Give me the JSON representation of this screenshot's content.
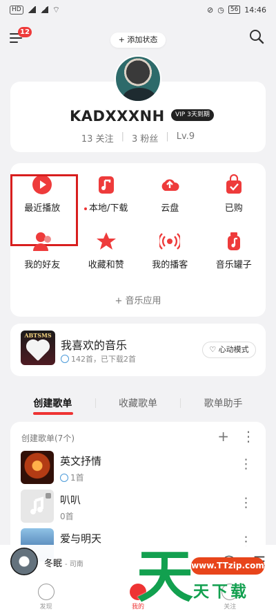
{
  "status_bar": {
    "left": "HD",
    "right_time": "14:46",
    "battery": "56"
  },
  "header": {
    "menu_badge": "12",
    "add_status": "+ 添加状态"
  },
  "profile": {
    "username": "KADXXXNH",
    "vip_badge": "VIP 3天到期",
    "following": "13 关注",
    "fans": "3 粉丝",
    "level": "Lv.9"
  },
  "grid_items": [
    {
      "label": "最近播放",
      "icon": "play-circle-icon"
    },
    {
      "label": "本地/下载",
      "icon": "music-file-icon"
    },
    {
      "label": "云盘",
      "icon": "cloud-upload-icon"
    },
    {
      "label": "已购",
      "icon": "shopping-bag-icon"
    },
    {
      "label": "我的好友",
      "icon": "friends-icon"
    },
    {
      "label": "收藏和赞",
      "icon": "star-icon"
    },
    {
      "label": "我的播客",
      "icon": "podcast-icon"
    },
    {
      "label": "音乐罐子",
      "icon": "music-jar-icon"
    }
  ],
  "add_app": "+ 音乐应用",
  "favorite": {
    "title": "我喜欢的音乐",
    "subtitle": "142首，已下载2首",
    "mode": "心动模式"
  },
  "tabs": [
    "创建歌单",
    "收藏歌单",
    "歌单助手"
  ],
  "playlist_section": {
    "header": "创建歌单(7个)",
    "add": "+",
    "more": "⋮"
  },
  "playlists": [
    {
      "title": "英文抒情",
      "count": "1首",
      "cover": "concert"
    },
    {
      "title": "叭叭",
      "count": "0首",
      "cover": "blank"
    },
    {
      "title": "爱与明天",
      "count": "",
      "cover": "portrait"
    }
  ],
  "player": {
    "song": "冬眠",
    "artist": "- 司南"
  },
  "bottom_nav": [
    {
      "label": "发现",
      "active": false
    },
    {
      "label": "我的",
      "active": true
    },
    {
      "label": "关注",
      "active": false
    }
  ],
  "watermark": {
    "main": "天",
    "url": "www.TTzip.com",
    "sub": "天下载"
  },
  "colors": {
    "accent": "#e33",
    "highlight_box": "#d81e1e",
    "watermark_green": "#12a04f",
    "watermark_orange": "#e8451b"
  }
}
